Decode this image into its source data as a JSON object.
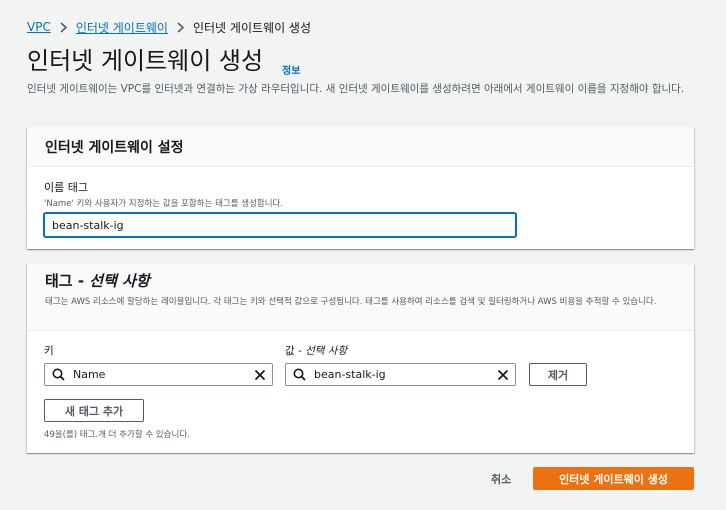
{
  "colors": {
    "accent": "#ec7211",
    "link": "#0073bb",
    "background": "#f2f3f3"
  },
  "breadcrumb": {
    "items": [
      "VPC",
      "인터넷 게이트웨이",
      "인터넷 게이트웨이 생성"
    ],
    "separator_icon": "chevron-right-icon"
  },
  "page": {
    "title": "인터넷 게이트웨이 생성",
    "info_link": "정보",
    "description": "인터넷 게이트웨이는 VPC를 인터넷과 연결하는 가상 라우터입니다. 새 인터넷 게이트웨이를 생성하려면 아래에서 게이트웨이 이름을 지정해야 합니다."
  },
  "settings_panel": {
    "title": "인터넷 게이트웨이 설정",
    "name_label": "이름 태그",
    "name_description": "'Name' 키와 사용자가 지정하는 값을 포함하는 태그를 생성합니다.",
    "name_value": "bean-stalk-ig"
  },
  "tags_panel": {
    "title_main": "태그 - ",
    "title_optional": "선택 사항",
    "description": "태그는 AWS 리소스에 할당하는 레이블입니다. 각 태그는 키와 선택적 값으로 구성됩니다. 태그를 사용하여 리소스를 검색 및 필터링하거나 AWS 비용을 추적할 수 있습니다.",
    "key_label": "키",
    "value_label_main": "값 - ",
    "value_label_optional": "선택 사항",
    "tags": [
      {
        "key": "Name",
        "value": "bean-stalk-ig"
      }
    ],
    "remove_button": "제거",
    "add_tag_button": "새 태그 추가",
    "remaining_note": "49을(를) 태그.개 더 추가할 수 있습니다.",
    "search_icon": "search-icon",
    "clear_icon": "close-icon"
  },
  "footer": {
    "cancel": "취소",
    "create": "인터넷 게이트웨이 생성"
  }
}
